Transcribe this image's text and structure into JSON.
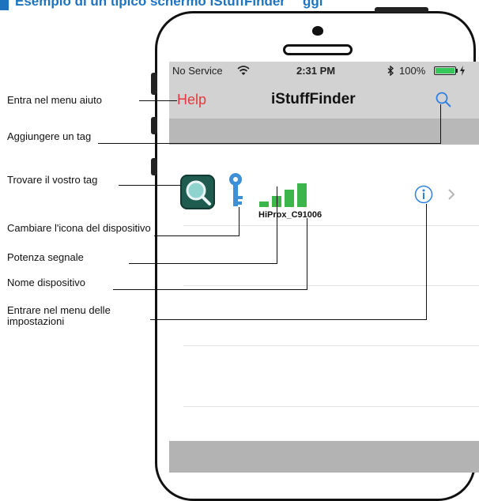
{
  "header": {
    "fragment": "Esempio di un tipico schermo iStuffFinder",
    "fragment_right": "ggi"
  },
  "status_bar": {
    "carrier": "No Service",
    "wifi_icon": "wifi-icon",
    "time": "2:31 PM",
    "bluetooth_icon": "bluetooth-icon",
    "battery": "100%"
  },
  "nav": {
    "help_label": "Help",
    "title": "iStuffFinder",
    "search_icon": "search-icon"
  },
  "device": {
    "name": "HiProx_C91006",
    "icon": "key-icon",
    "finder_icon": "magnifier-app-icon",
    "info_icon": "info-icon",
    "disclosure_icon": "chevron-right-icon",
    "signal_bars": 4,
    "signal_level": 1.0
  },
  "callouts": {
    "help": "Entra nel menu aiuto",
    "add_tag": "Aggiungere un tag",
    "find_tag": "Trovare il vostro tag",
    "change_icon": "Cambiare l'icona del dispositivo",
    "signal": "Potenza segnale",
    "device_name": "Nome dispositivo",
    "settings": "Entrare nel menu delle impostazioni"
  },
  "colors": {
    "accent_blue": "#1e73be",
    "help_red": "#e0393e",
    "signal_green": "#3cb54a",
    "battery_green": "#34c759",
    "key_blue": "#3d8fd6",
    "info_blue": "#2f7fe0"
  }
}
